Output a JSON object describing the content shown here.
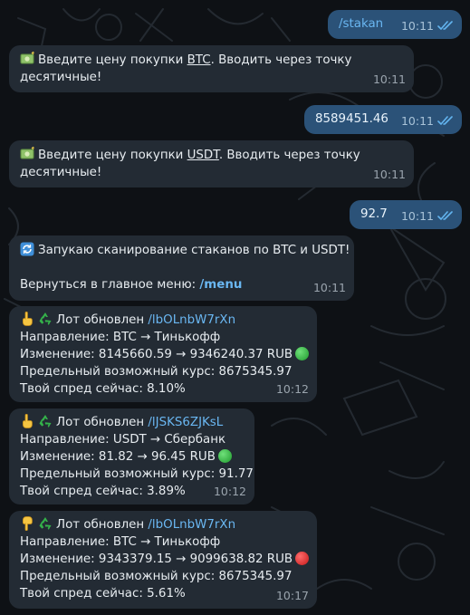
{
  "messages": {
    "m1": {
      "text": "/stakan",
      "time": "10:11"
    },
    "m2": {
      "l1_pre": "Введите цену покупки ",
      "l1_link": "BTC",
      "l1_post": ". Вводить через точку",
      "l2": "десятичные!",
      "time": "10:11"
    },
    "m3": {
      "text": "8589451.46",
      "time": "10:11"
    },
    "m4": {
      "l1_pre": "Введите цену покупки ",
      "l1_link": "USDT",
      "l1_post": ". Вводить через точку",
      "l2": "десятичные!",
      "time": "10:11"
    },
    "m5": {
      "text": "92.7",
      "time": "10:11"
    },
    "m6": {
      "l1": "Запукаю сканирование стаканов по BTC и USDT!",
      "l2_pre": "Вернуться в главное меню: ",
      "l2_cmd": "/menu",
      "time": "10:11"
    },
    "m7": {
      "title_pre": "Лот обновлен ",
      "title_link": "/lbOLnbW7rXn",
      "dir": "Направление: BTC → Тинькофф",
      "change": "Изменение: 8145660.59 → 9346240.37 RUB",
      "limit": "Предельный возможный курс: 8675345.97",
      "spread": "Твой спред сейчас: 8.10%",
      "status": "green",
      "time": "10:12"
    },
    "m8": {
      "title_pre": "Лот обновлен ",
      "title_link": "/lJSKS6ZJKsL",
      "dir": "Направление: USDT → Сбербанк",
      "change": "Изменение: 81.82 → 96.45 RUB",
      "limit": "Предельный возможный курс: 91.77",
      "spread": "Твой спред сейчас: 3.89%",
      "status": "green",
      "time": "10:12"
    },
    "m9": {
      "title_pre": "Лот обновлен ",
      "title_link": "/lbOLnbW7rXn",
      "dir": "Направление: BTC → Тинькофф",
      "change": "Изменение: 9343379.15 → 9099638.82 RUB",
      "limit": "Предельный возможный курс: 8675345.97",
      "spread": "Твой спред сейчас: 5.61%",
      "status": "red",
      "time": "10:17"
    }
  },
  "icons": {
    "money": "money-with-wings-icon",
    "refresh": "arrows-counterclockwise-icon",
    "point_up": "point-up-hand-icon",
    "point_down": "point-down-hand-icon",
    "recycle": "recycle-icon",
    "read_ticks": "double-check-icon"
  },
  "colors": {
    "background": "#0e1115",
    "incoming_bubble": "#232b34",
    "outgoing_bubble": "#2b5278",
    "link": "#6ab7f2",
    "status_green": "#2fb53d",
    "status_red": "#e12525"
  }
}
